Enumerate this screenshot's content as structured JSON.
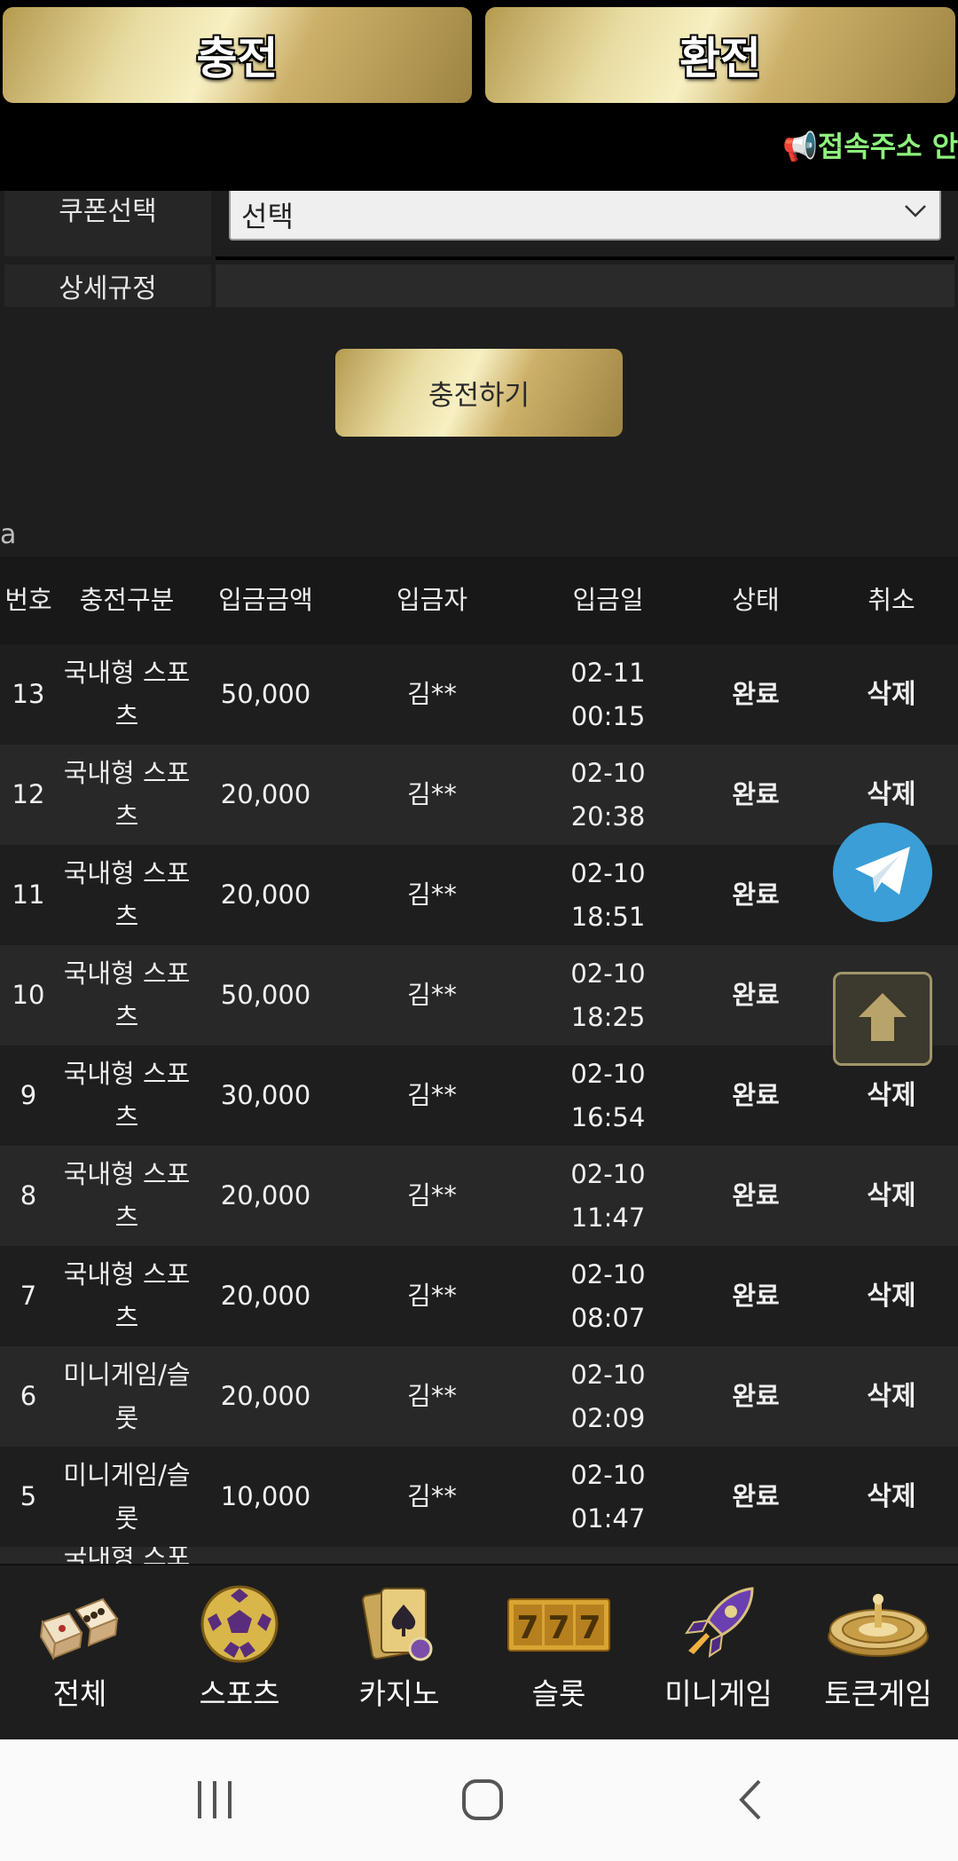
{
  "tabs": {
    "deposit": "충전",
    "withdraw": "환전"
  },
  "ticker": {
    "icon": "megaphone-icon",
    "text": "📢접속주소 안"
  },
  "form": {
    "coupon_label": "쿠폰선택",
    "coupon_value": "선택",
    "detail_label": "상세규정",
    "submit_label": "충전하기"
  },
  "section_mark": "a",
  "table": {
    "headers": {
      "no": "번호",
      "type": "충전구분",
      "amount": "입금금액",
      "depositor": "입금자",
      "date": "입금일",
      "status": "상태",
      "cancel": "취소"
    },
    "rows": [
      {
        "no": "13",
        "type": "국내형 스포츠",
        "amount": "50,000",
        "depositor": "김**",
        "date": "02-11 00:15",
        "status": "완료",
        "cancel": "삭제"
      },
      {
        "no": "12",
        "type": "국내형 스포츠",
        "amount": "20,000",
        "depositor": "김**",
        "date": "02-10 20:38",
        "status": "완료",
        "cancel": "삭제"
      },
      {
        "no": "11",
        "type": "국내형 스포츠",
        "amount": "20,000",
        "depositor": "김**",
        "date": "02-10 18:51",
        "status": "완료",
        "cancel": ""
      },
      {
        "no": "10",
        "type": "국내형 스포츠",
        "amount": "50,000",
        "depositor": "김**",
        "date": "02-10 18:25",
        "status": "완료",
        "cancel": ""
      },
      {
        "no": "9",
        "type": "국내형 스포츠",
        "amount": "30,000",
        "depositor": "김**",
        "date": "02-10 16:54",
        "status": "완료",
        "cancel": "삭제"
      },
      {
        "no": "8",
        "type": "국내형 스포츠",
        "amount": "20,000",
        "depositor": "김**",
        "date": "02-10 11:47",
        "status": "완료",
        "cancel": "삭제"
      },
      {
        "no": "7",
        "type": "국내형 스포츠",
        "amount": "20,000",
        "depositor": "김**",
        "date": "02-10 08:07",
        "status": "완료",
        "cancel": "삭제"
      },
      {
        "no": "6",
        "type": "미니게임/슬롯",
        "amount": "20,000",
        "depositor": "김**",
        "date": "02-10 02:09",
        "status": "완료",
        "cancel": "삭제"
      },
      {
        "no": "5",
        "type": "미니게임/슬롯",
        "amount": "10,000",
        "depositor": "김**",
        "date": "02-10 01:47",
        "status": "완료",
        "cancel": "삭제"
      },
      {
        "no": "",
        "type": "국내형 스포",
        "amount": "",
        "depositor": "",
        "date": "",
        "status": "",
        "cancel": ""
      }
    ]
  },
  "floating": {
    "telegram_icon": "telegram-icon",
    "scroll_top_icon": "arrow-up-icon"
  },
  "game_nav": [
    {
      "label": "전체",
      "icon": "dice-icon"
    },
    {
      "label": "스포츠",
      "icon": "soccer-ball-icon"
    },
    {
      "label": "카지노",
      "icon": "playing-cards-icon"
    },
    {
      "label": "슬롯",
      "icon": "slot-777-icon"
    },
    {
      "label": "미니게임",
      "icon": "rocket-icon"
    },
    {
      "label": "토큰게임",
      "icon": "roulette-icon"
    }
  ],
  "system_nav": {
    "recents": "recents-icon",
    "home": "home-icon",
    "back": "back-icon"
  },
  "colors": {
    "gold_light": "#f7f0c3",
    "gold_dark": "#9d8441",
    "background": "#1e1e1e",
    "ticker": "#8df27c",
    "telegram": "#3b9ed6"
  }
}
